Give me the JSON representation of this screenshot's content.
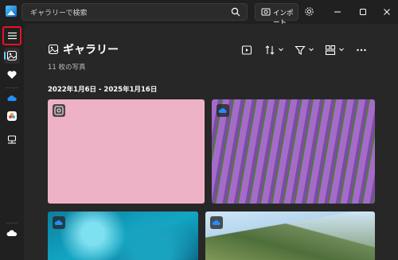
{
  "search": {
    "placeholder": "ギャラリーで検索"
  },
  "toolbar": {
    "import_label": "インポート"
  },
  "gallery": {
    "title": "ギャラリー",
    "count": "11 枚の写真",
    "date_range": "2022年1月6日 - 2025年1月16日"
  },
  "sidebar": {
    "items": [
      {
        "name": "menu-icon"
      },
      {
        "name": "gallery-icon",
        "active": true
      },
      {
        "name": "heart-icon"
      },
      {
        "name": "onedrive-icon"
      },
      {
        "name": "icloud-photos-icon"
      },
      {
        "name": "this-pc-icon"
      },
      {
        "name": "cloud-icon"
      }
    ]
  },
  "colors": {
    "accent": "#60cdff",
    "highlight": "#e81123",
    "background": "#202020",
    "panel": "#272727"
  },
  "photos": [
    {
      "name": "cherry-blossom-photo",
      "badge": "icloud-photos-icon"
    },
    {
      "name": "lavender-field-photo",
      "badge": "onedrive-icon"
    },
    {
      "name": "underwater-photo",
      "badge": "onedrive-icon"
    },
    {
      "name": "mountain-landscape-photo",
      "badge": "onedrive-icon"
    }
  ]
}
